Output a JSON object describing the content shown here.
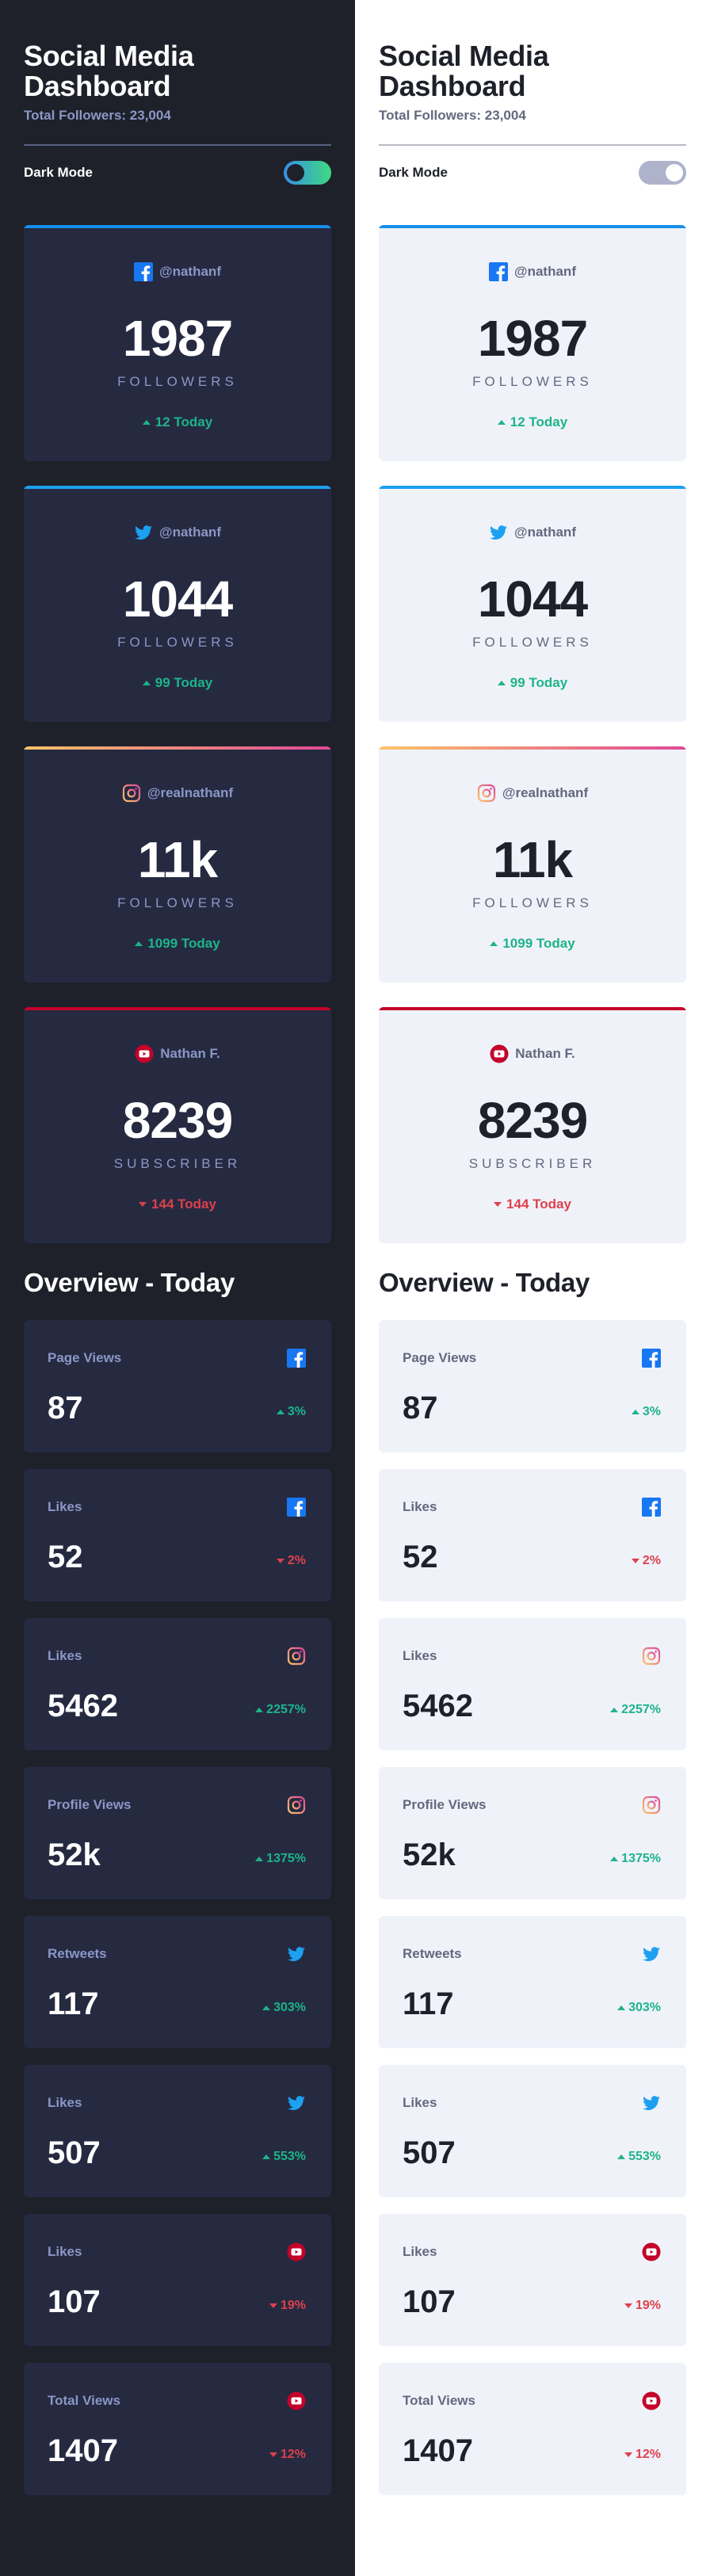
{
  "header": {
    "title": "Social Media Dashboard",
    "subtitle": "Total Followers: 23,004",
    "toggle_label": "Dark Mode"
  },
  "overview_title": "Overview - Today",
  "colors": {
    "dark_bg": "#1e202a",
    "dark_card": "#252a41",
    "light_bg": "#ffffff",
    "light_card": "#f0f2fa",
    "up": "#1db489",
    "down": "#dc414c",
    "facebook": "#178fe9",
    "twitter": "#1ca0f2",
    "youtube": "#c4032a"
  },
  "panels": [
    {
      "theme": "dark",
      "dark_mode_on": true
    },
    {
      "theme": "light",
      "dark_mode_on": false
    }
  ],
  "cards": [
    {
      "platform": "facebook",
      "icon": "facebook-icon",
      "handle": "@nathanf",
      "count": "1987",
      "unit": "FOLLOWERS",
      "today": "12 Today",
      "trend": "up"
    },
    {
      "platform": "twitter",
      "icon": "twitter-icon",
      "handle": "@nathanf",
      "count": "1044",
      "unit": "FOLLOWERS",
      "today": "99 Today",
      "trend": "up"
    },
    {
      "platform": "instagram",
      "icon": "instagram-icon",
      "handle": "@realnathanf",
      "count": "11k",
      "unit": "FOLLOWERS",
      "today": "1099 Today",
      "trend": "up"
    },
    {
      "platform": "youtube",
      "icon": "youtube-icon",
      "handle": "Nathan F.",
      "count": "8239",
      "unit": "SUBSCRIBER",
      "today": "144 Today",
      "trend": "down"
    }
  ],
  "stats": [
    {
      "label": "Page Views",
      "platform": "facebook",
      "icon": "facebook-icon",
      "value": "87",
      "pct": "3%",
      "trend": "up"
    },
    {
      "label": "Likes",
      "platform": "facebook",
      "icon": "facebook-icon",
      "value": "52",
      "pct": "2%",
      "trend": "down"
    },
    {
      "label": "Likes",
      "platform": "instagram",
      "icon": "instagram-icon",
      "value": "5462",
      "pct": "2257%",
      "trend": "up"
    },
    {
      "label": "Profile Views",
      "platform": "instagram",
      "icon": "instagram-icon",
      "value": "52k",
      "pct": "1375%",
      "trend": "up"
    },
    {
      "label": "Retweets",
      "platform": "twitter",
      "icon": "twitter-icon",
      "value": "117",
      "pct": "303%",
      "trend": "up"
    },
    {
      "label": "Likes",
      "platform": "twitter",
      "icon": "twitter-icon",
      "value": "507",
      "pct": "553%",
      "trend": "up"
    },
    {
      "label": "Likes",
      "platform": "youtube",
      "icon": "youtube-icon",
      "value": "107",
      "pct": "19%",
      "trend": "down"
    },
    {
      "label": "Total Views",
      "platform": "youtube",
      "icon": "youtube-icon",
      "value": "1407",
      "pct": "12%",
      "trend": "down"
    }
  ]
}
